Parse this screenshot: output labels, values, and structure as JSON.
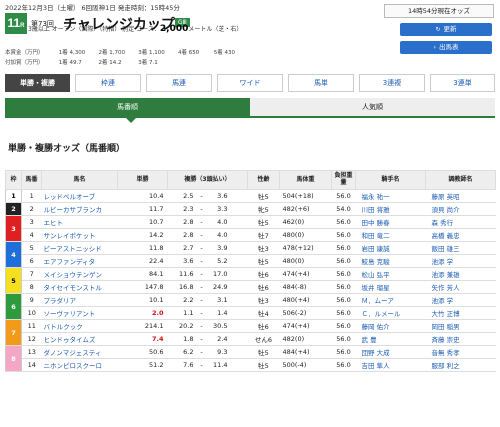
{
  "header": {
    "date_line": "2022年12月3日（土曜） 6回阪神1日 発走時刻：15時45分",
    "race_number": "11",
    "race_suffix": "R",
    "edition": "第73回",
    "race_name": "チャレンジカップ",
    "grade": "GⅢ",
    "conditions_left": "3歳以上 オープン（国際）（特指） 別定 コース：",
    "distance": "2,000",
    "conditions_right": "メートル（芝・右）",
    "prize_rows": [
      {
        "label": "本賞金（万円）",
        "items": [
          "1着 4,300",
          "2着 1,700",
          "3着 1,100",
          "4着 650",
          "5着 430"
        ]
      },
      {
        "label": "付加賞（万円）",
        "items": [
          "1着 49.7",
          "2着 14.2",
          "3着 7.1"
        ]
      }
    ]
  },
  "status": {
    "text": "14時54分現在オッズ",
    "update_label": "更新",
    "print_label": "出馬表",
    "update_icon": "refresh-icon",
    "print_icon": "chevron-right-icon"
  },
  "tabs": [
    "単勝・複勝",
    "枠連",
    "馬連",
    "ワイド",
    "馬単",
    "3連複",
    "3連単"
  ],
  "subtabs": [
    "馬番順",
    "人気順"
  ],
  "section_title": "単勝・複勝オッズ（馬番順）",
  "table": {
    "headers": [
      "枠",
      "馬番",
      "馬名",
      "単勝",
      "複勝（3頭払い）",
      "性齢",
      "馬体重",
      "負担重量",
      "騎手名",
      "調教師名"
    ],
    "waku_colors": {
      "1": {
        "bg": "#ffffff",
        "fg": "#000000"
      },
      "2": {
        "bg": "#222222",
        "fg": "#ffffff"
      },
      "3": {
        "bg": "#e02020",
        "fg": "#ffffff"
      },
      "4": {
        "bg": "#1e6fd9",
        "fg": "#ffffff"
      },
      "5": {
        "bg": "#f5e020",
        "fg": "#000000"
      },
      "6": {
        "bg": "#2e9a3e",
        "fg": "#ffffff"
      },
      "7": {
        "bg": "#f39a1a",
        "fg": "#ffffff"
      },
      "8": {
        "bg": "#f5a6c4",
        "fg": "#ffffff"
      }
    },
    "rows": [
      {
        "waku": "1",
        "num": "1",
        "name": "レッドベルオーブ",
        "win": "10.4",
        "place_lo": "2.5",
        "place_hi": "3.6",
        "sex_age": "牡5",
        "weight": "504(+18)",
        "burden": "56.0",
        "jockey": "福永 祐一",
        "trainer": "藤原 英昭"
      },
      {
        "waku": "2",
        "num": "2",
        "name": "ルビーカサブランカ",
        "win": "11.7",
        "place_lo": "2.3",
        "place_hi": "3.3",
        "sex_age": "牝5",
        "weight": "482(+6)",
        "burden": "54.0",
        "jockey": "川田 将雅",
        "trainer": "須貝 尚介"
      },
      {
        "waku": "3",
        "num": "3",
        "name": "エヒト",
        "win": "10.7",
        "place_lo": "2.8",
        "place_hi": "4.0",
        "sex_age": "牡5",
        "weight": "462(0)",
        "burden": "56.0",
        "jockey": "田中 勝春",
        "trainer": "森 秀行"
      },
      {
        "waku": "3",
        "num": "4",
        "name": "サンレイポケット",
        "win": "14.2",
        "place_lo": "2.8",
        "place_hi": "4.0",
        "sex_age": "牡7",
        "weight": "480(0)",
        "burden": "56.0",
        "jockey": "和田 竜二",
        "trainer": "高橋 義忠"
      },
      {
        "waku": "4",
        "num": "5",
        "name": "ビーアストニッシド",
        "win": "11.8",
        "place_lo": "2.7",
        "place_hi": "3.9",
        "sex_age": "牡3",
        "weight": "478(+12)",
        "burden": "56.0",
        "jockey": "岩田 康誠",
        "trainer": "飯田 雄三"
      },
      {
        "waku": "4",
        "num": "6",
        "name": "エアファンディタ",
        "win": "22.4",
        "place_lo": "3.6",
        "place_hi": "5.2",
        "sex_age": "牡5",
        "weight": "480(0)",
        "burden": "56.0",
        "jockey": "鮫島 克駿",
        "trainer": "池添 学"
      },
      {
        "waku": "5",
        "num": "7",
        "name": "メイショウテンゲン",
        "win": "84.1",
        "place_lo": "11.6",
        "place_hi": "17.0",
        "sex_age": "牡6",
        "weight": "474(+4)",
        "burden": "56.0",
        "jockey": "松山 弘平",
        "trainer": "池添 兼雄"
      },
      {
        "waku": "5",
        "num": "8",
        "name": "タイセイモンストル",
        "win": "147.8",
        "place_lo": "16.8",
        "place_hi": "24.9",
        "sex_age": "牡6",
        "weight": "484(-8)",
        "burden": "56.0",
        "jockey": "坂井 瑠星",
        "trainer": "矢作 芳人"
      },
      {
        "waku": "6",
        "num": "9",
        "name": "プラダリア",
        "win": "10.1",
        "place_lo": "2.2",
        "place_hi": "3.1",
        "sex_age": "牡3",
        "weight": "480(+4)",
        "burden": "56.0",
        "jockey": "Ｍ．ムーア",
        "trainer": "池添 学"
      },
      {
        "waku": "6",
        "num": "10",
        "name": "ソーヴァリアント",
        "win": "2.0",
        "place_lo": "1.1",
        "place_hi": "1.4",
        "sex_age": "牡4",
        "weight": "506(-2)",
        "burden": "56.0",
        "jockey": "Ｃ．ルメール",
        "trainer": "大竹 正博"
      },
      {
        "waku": "7",
        "num": "11",
        "name": "バトルクック",
        "win": "214.1",
        "place_lo": "20.2",
        "place_hi": "30.5",
        "sex_age": "牡6",
        "weight": "474(+4)",
        "burden": "56.0",
        "jockey": "藤岡 佑介",
        "trainer": "岡田 稲男"
      },
      {
        "waku": "7",
        "num": "12",
        "name": "ヒンドゥタイムズ",
        "win": "7.4",
        "place_lo": "1.8",
        "place_hi": "2.4",
        "sex_age": "せん6",
        "weight": "482(0)",
        "burden": "56.0",
        "jockey": "武 豊",
        "trainer": "斉藤 崇史"
      },
      {
        "waku": "8",
        "num": "13",
        "name": "ダノンマジェスティ",
        "win": "50.6",
        "place_lo": "6.2",
        "place_hi": "9.3",
        "sex_age": "牡5",
        "weight": "484(+4)",
        "burden": "56.0",
        "jockey": "団野 大成",
        "trainer": "音無 秀孝"
      },
      {
        "waku": "8",
        "num": "14",
        "name": "ニホンピロスクーロ",
        "win": "51.2",
        "place_lo": "7.6",
        "place_hi": "11.4",
        "sex_age": "牡5",
        "weight": "500(-4)",
        "burden": "56.0",
        "jockey": "吉田 隼人",
        "trainer": "服部 利之"
      }
    ]
  }
}
